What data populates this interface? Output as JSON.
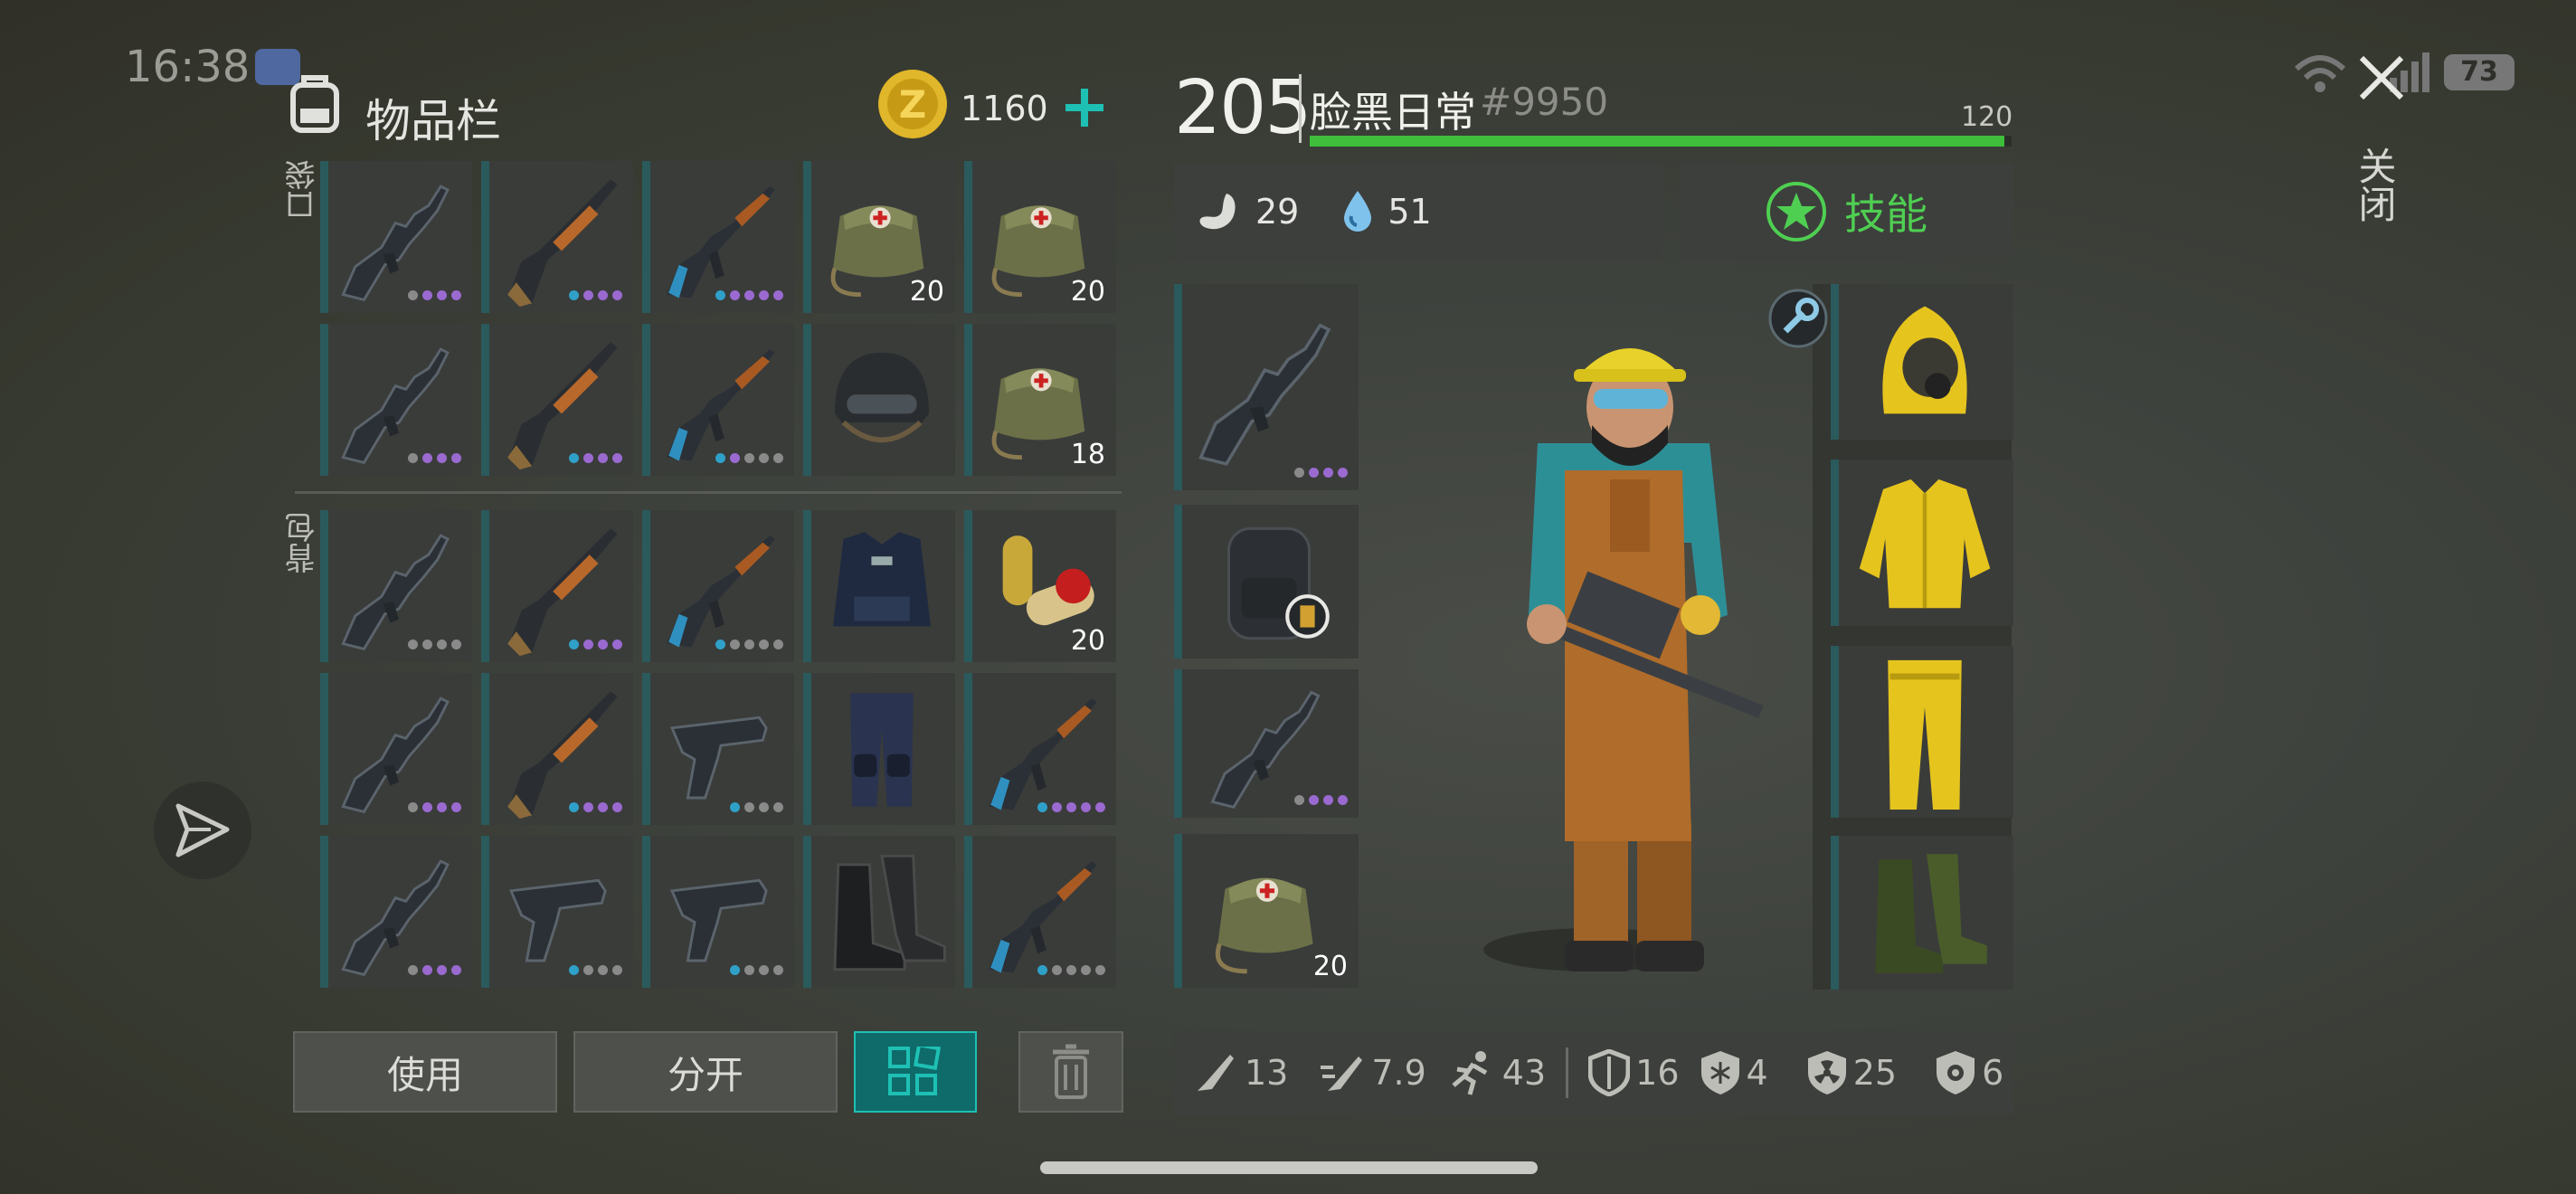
{
  "status": {
    "time": "16:38",
    "battery": "73"
  },
  "inventory": {
    "title": "物品栏",
    "coins": "1160",
    "pockets_label": "口袋",
    "backpack_label": "背包",
    "pockets": [
      {
        "icon": "rifle-icon",
        "dots": [
          "#8a8a8a",
          "#9a6ad0",
          "#9a6ad0",
          "#9a6ad0"
        ]
      },
      {
        "icon": "shotgun-icon",
        "dots": [
          "#2fa0c8",
          "#9a6ad0",
          "#9a6ad0",
          "#9a6ad0"
        ]
      },
      {
        "icon": "ak-rifle-icon",
        "dots": [
          "#2fa0c8",
          "#9a6ad0",
          "#9a6ad0",
          "#9a6ad0",
          "#9a6ad0"
        ]
      },
      {
        "icon": "medkit-bag-icon",
        "count": "20"
      },
      {
        "icon": "medkit-bag-icon",
        "count": "20"
      },
      {
        "icon": "rifle-icon",
        "dots": [
          "#8a8a8a",
          "#9a6ad0",
          "#9a6ad0",
          "#9a6ad0"
        ]
      },
      {
        "icon": "shotgun-icon",
        "dots": [
          "#2fa0c8",
          "#9a6ad0",
          "#9a6ad0",
          "#9a6ad0"
        ]
      },
      {
        "icon": "ak-rifle-icon",
        "dots": [
          "#2fa0c8",
          "#9a6ad0",
          "#8a8a8a",
          "#8a8a8a",
          "#8a8a8a"
        ]
      },
      {
        "icon": "helmet-icon"
      },
      {
        "icon": "medkit-bag-icon",
        "count": "18"
      }
    ],
    "backpack": [
      {
        "icon": "rifle-icon",
        "dots": [
          "#8a8a8a",
          "#8a8a8a",
          "#8a8a8a",
          "#8a8a8a"
        ]
      },
      {
        "icon": "shotgun-icon",
        "dots": [
          "#2fa0c8",
          "#9a6ad0",
          "#9a6ad0",
          "#9a6ad0"
        ]
      },
      {
        "icon": "ak-rifle-icon",
        "dots": [
          "#2fa0c8",
          "#8a8a8a",
          "#8a8a8a",
          "#8a8a8a",
          "#8a8a8a"
        ]
      },
      {
        "icon": "tactical-vest-icon"
      },
      {
        "icon": "pills-icon",
        "count": "20"
      },
      {
        "icon": "rifle-icon",
        "dots": [
          "#8a8a8a",
          "#9a6ad0",
          "#9a6ad0",
          "#9a6ad0"
        ]
      },
      {
        "icon": "shotgun-icon",
        "dots": [
          "#2fa0c8",
          "#9a6ad0",
          "#9a6ad0",
          "#9a6ad0"
        ]
      },
      {
        "icon": "pistol-icon",
        "dots": [
          "#2fa0c8",
          "#8a8a8a",
          "#8a8a8a",
          "#8a8a8a"
        ]
      },
      {
        "icon": "tactical-pants-icon"
      },
      {
        "icon": "ak-rifle-icon",
        "dots": [
          "#2fa0c8",
          "#9a6ad0",
          "#9a6ad0",
          "#9a6ad0",
          "#9a6ad0"
        ]
      },
      {
        "icon": "rifle-icon",
        "dots": [
          "#8a8a8a",
          "#9a6ad0",
          "#9a6ad0",
          "#9a6ad0"
        ]
      },
      {
        "icon": "pistol-icon",
        "dots": [
          "#2fa0c8",
          "#8a8a8a",
          "#8a8a8a",
          "#8a8a8a"
        ]
      },
      {
        "icon": "pistol-icon",
        "dots": [
          "#2fa0c8",
          "#8a8a8a",
          "#8a8a8a",
          "#8a8a8a"
        ]
      },
      {
        "icon": "boots-icon"
      },
      {
        "icon": "ak-rifle-icon",
        "dots": [
          "#2fa0c8",
          "#8a8a8a",
          "#8a8a8a",
          "#8a8a8a",
          "#8a8a8a"
        ]
      }
    ],
    "buttons": {
      "use": "使用",
      "split": "分开"
    }
  },
  "player": {
    "level": "205",
    "name": "脸黑日常",
    "tag": "#9950",
    "xp_max": "120",
    "xp_fraction": 0.99,
    "hunger": "29",
    "water": "51",
    "skills_label": "技能",
    "equip_left": [
      {
        "icon": "rifle-icon",
        "dots": [
          "#8a8a8a",
          "#9a6ad0",
          "#9a6ad0",
          "#9a6ad0"
        ]
      },
      {
        "icon": "backpack-icon"
      },
      {
        "icon": "rifle-icon",
        "dots": [
          "#8a8a8a",
          "#9a6ad0",
          "#9a6ad0",
          "#9a6ad0"
        ]
      },
      {
        "icon": "medkit-bag-icon",
        "count": "20"
      }
    ],
    "equip_right": [
      {
        "icon": "hazmat-hood-icon"
      },
      {
        "icon": "hazmat-jacket-icon"
      },
      {
        "icon": "hazmat-pants-icon"
      },
      {
        "icon": "rubber-boots-icon"
      }
    ],
    "stats": {
      "melee": "13",
      "speed_attack": "7.9",
      "run": "43",
      "armor": "16",
      "cold": "4",
      "radiation": "25",
      "infection": "6"
    }
  },
  "close_label": "关闭",
  "colors": {
    "accent": "#1ec0b4",
    "xp": "#3fbe3b",
    "skill": "#4fcf52",
    "coin": "#e0b62a"
  }
}
